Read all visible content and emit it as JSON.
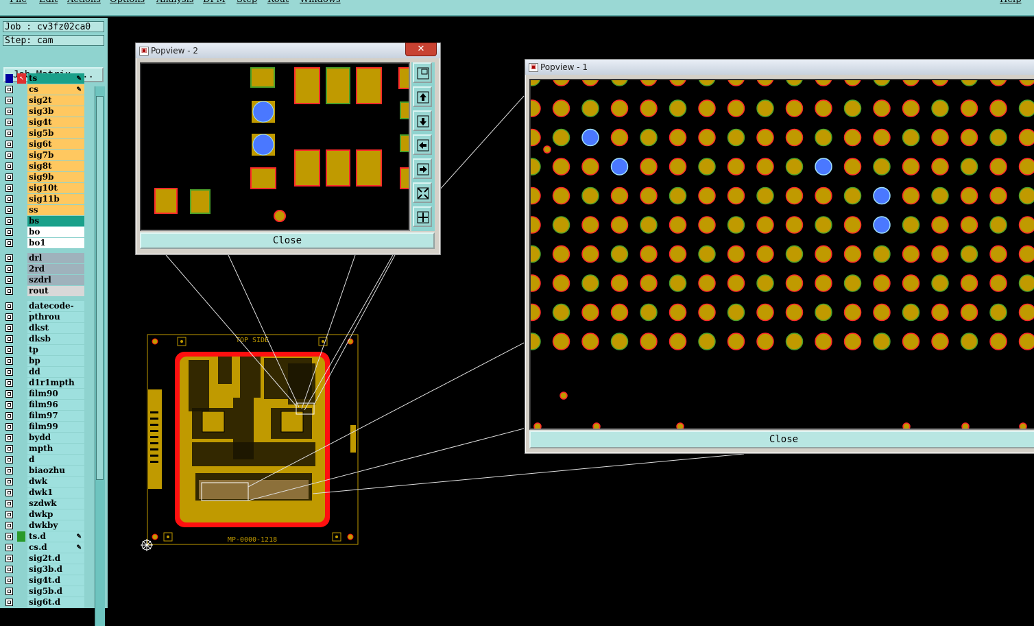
{
  "menu": [
    "File",
    "Edit",
    "Actions",
    "Options",
    "Analysis",
    "DFM",
    "Step",
    "Rout",
    "Windows",
    "Help"
  ],
  "info": {
    "job": "Job : cv3fz02ca0",
    "step": "Step: cam",
    "job_matrix": "Job Matrix ..."
  },
  "layers_board": [
    {
      "name": "ts",
      "color": "#1aa08a",
      "edit": true
    },
    {
      "name": "cs",
      "color": "#ffc860",
      "edit": true
    },
    {
      "name": "sig2t",
      "color": "#ffc860"
    },
    {
      "name": "sig3b",
      "color": "#ffc860"
    },
    {
      "name": "sig4t",
      "color": "#ffc860"
    },
    {
      "name": "sig5b",
      "color": "#ffc860"
    },
    {
      "name": "sig6t",
      "color": "#ffc860"
    },
    {
      "name": "sig7b",
      "color": "#ffc860"
    },
    {
      "name": "sig8t",
      "color": "#ffc860"
    },
    {
      "name": "sig9b",
      "color": "#ffc860"
    },
    {
      "name": "sig10t",
      "color": "#ffc860"
    },
    {
      "name": "sig11b",
      "color": "#ffc860"
    },
    {
      "name": "ss",
      "color": "#ffc860"
    },
    {
      "name": "bs",
      "color": "#1aa08a"
    },
    {
      "name": "bo",
      "color": "#ffffff"
    },
    {
      "name": "bo1",
      "color": "#ffffff"
    }
  ],
  "layers_drill": [
    {
      "name": "drl",
      "color": "#9fb2bc"
    },
    {
      "name": "2rd",
      "color": "#9fb2bc"
    },
    {
      "name": "szdrl",
      "color": "#9fb2bc"
    },
    {
      "name": "rout",
      "color": "#d8d8d8"
    }
  ],
  "layers_misc": [
    {
      "name": "datecode-bo",
      "color": "#9ee0de"
    },
    {
      "name": "pthrou",
      "color": "#9ee0de"
    },
    {
      "name": "dkst",
      "color": "#9ee0de"
    },
    {
      "name": "dksb",
      "color": "#9ee0de"
    },
    {
      "name": "tp",
      "color": "#9ee0de"
    },
    {
      "name": "bp",
      "color": "#9ee0de"
    },
    {
      "name": "dd",
      "color": "#9ee0de"
    },
    {
      "name": "d1r1mpth",
      "color": "#9ee0de"
    },
    {
      "name": "film90",
      "color": "#9ee0de"
    },
    {
      "name": "film96",
      "color": "#9ee0de"
    },
    {
      "name": "film97",
      "color": "#9ee0de"
    },
    {
      "name": "film99",
      "color": "#9ee0de"
    },
    {
      "name": "bydd",
      "color": "#9ee0de"
    },
    {
      "name": "mpth",
      "color": "#9ee0de"
    },
    {
      "name": "d",
      "color": "#9ee0de"
    },
    {
      "name": "biaozhu",
      "color": "#9ee0de"
    },
    {
      "name": "dwk",
      "color": "#9ee0de"
    },
    {
      "name": "dwk1",
      "color": "#9ee0de"
    },
    {
      "name": "szdwk",
      "color": "#9ee0de"
    },
    {
      "name": "dwkp",
      "color": "#9ee0de"
    },
    {
      "name": "dwkby",
      "color": "#9ee0de"
    },
    {
      "name": "ts.d",
      "color": "#9ee0de",
      "edit": true,
      "mark": true
    },
    {
      "name": "cs.d",
      "color": "#9ee0de",
      "edit": true
    },
    {
      "name": "sig2t.d",
      "color": "#9ee0de"
    },
    {
      "name": "sig3b.d",
      "color": "#9ee0de"
    },
    {
      "name": "sig4t.d",
      "color": "#9ee0de"
    },
    {
      "name": "sig5b.d",
      "color": "#9ee0de"
    },
    {
      "name": "sig6t.d",
      "color": "#9ee0de"
    }
  ],
  "popview2": {
    "title": "Popview - 2",
    "close_label": "Close"
  },
  "popview1": {
    "title": "Popview - 1",
    "close_label": "Close"
  },
  "board": {
    "top_text": "TOP SIDE",
    "bottom_text": "MP-0000-1218"
  },
  "colors": {
    "pad": "#c09a00",
    "pad_outline": "#ff2a2a",
    "via_blue": "#4a78ff",
    "panel": "#8fd3cf",
    "board_border": "#ff1010"
  }
}
